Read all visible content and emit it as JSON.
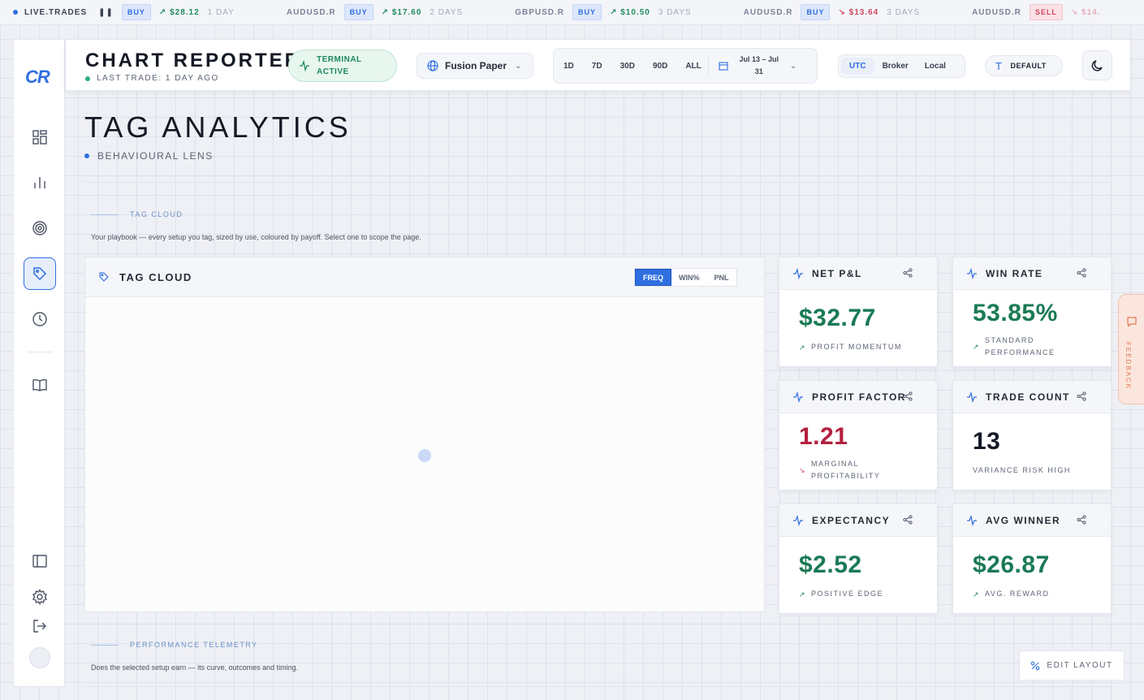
{
  "ticker": {
    "label": "LIVE.TRADES",
    "pause_icon": "pause-icon",
    "items": [
      {
        "symbol": "",
        "side": "BUY",
        "amount": "$28.12",
        "direction": "up",
        "duration": "1 DAY"
      },
      {
        "symbol": "AUDUSD.R",
        "side": "BUY",
        "amount": "$17.60",
        "direction": "up",
        "duration": "2 DAYS"
      },
      {
        "symbol": "GBPUSD.R",
        "side": "BUY",
        "amount": "$10.50",
        "direction": "up",
        "duration": "3 DAYS"
      },
      {
        "symbol": "AUDUSD.R",
        "side": "BUY",
        "amount": "$13.64",
        "direction": "down",
        "duration": "3 DAYS"
      },
      {
        "symbol": "AUDUSD.R",
        "side": "SELL",
        "amount": "$14.",
        "direction": "down",
        "duration": ""
      }
    ]
  },
  "header": {
    "brand": "CHART REPORTER",
    "last_trade": "LAST TRADE: 1 DAY AGO",
    "terminal_status": "TERMINAL ACTIVE",
    "account": "Fusion Paper",
    "ranges": [
      "1D",
      "7D",
      "30D",
      "90D",
      "ALL"
    ],
    "date_range": "Jul 13 – Jul 31",
    "timezones": [
      "UTC",
      "Broker",
      "Local"
    ],
    "timezone_selected": "UTC",
    "font_setting": "DEFAULT"
  },
  "sidebar": {
    "logo": "CR",
    "items": [
      "dashboard-icon",
      "bar-chart-icon",
      "target-icon",
      "tag-icon",
      "clock-icon",
      "book-icon"
    ],
    "active": "tag-icon",
    "bottom": [
      "panel-toggle-icon",
      "gear-icon",
      "logout-icon"
    ]
  },
  "page": {
    "title": "TAG ANALYTICS",
    "subtitle": "BEHAVIOURAL LENS"
  },
  "sections": {
    "tag_cloud_label": "TAG CLOUD",
    "tag_cloud_desc": "Your playbook — every setup you tag, sized by use, coloured by payoff. Select one to scope the page.",
    "telemetry_label": "PERFORMANCE TELEMETRY",
    "telemetry_desc": "Does the selected setup earn — its curve, outcomes and timing."
  },
  "cloud": {
    "title": "TAG CLOUD",
    "modes": [
      "FREQ",
      "WIN%",
      "PNL"
    ],
    "mode_selected": "FREQ"
  },
  "cards": [
    {
      "title": "NET P&L",
      "value": "$32.77",
      "tone": "green",
      "sub": "PROFIT MOMENTUM",
      "trend": "up"
    },
    {
      "title": "WIN RATE",
      "value": "53.85%",
      "tone": "green",
      "sub": "STANDARD PERFORMANCE",
      "trend": "up"
    },
    {
      "title": "PROFIT FACTOR",
      "value": "1.21",
      "tone": "red",
      "sub": "MARGINAL PROFITABILITY",
      "trend": "down"
    },
    {
      "title": "TRADE COUNT",
      "value": "13",
      "tone": "dark",
      "sub": "VARIANCE RISK HIGH",
      "trend": "none"
    },
    {
      "title": "EXPECTANCY",
      "value": "$2.52",
      "tone": "green",
      "sub": "POSITIVE EDGE",
      "trend": "up"
    },
    {
      "title": "AVG WINNER",
      "value": "$26.87",
      "tone": "green",
      "sub": "AVG. REWARD",
      "trend": "up"
    }
  ],
  "feedback": "FEEDBACK",
  "edit_layout": "EDIT LAYOUT",
  "colors": {
    "accent": "#2f6fe0",
    "positive": "#1a7a55",
    "negative": "#b3213f",
    "feedback": "#e07a52"
  }
}
